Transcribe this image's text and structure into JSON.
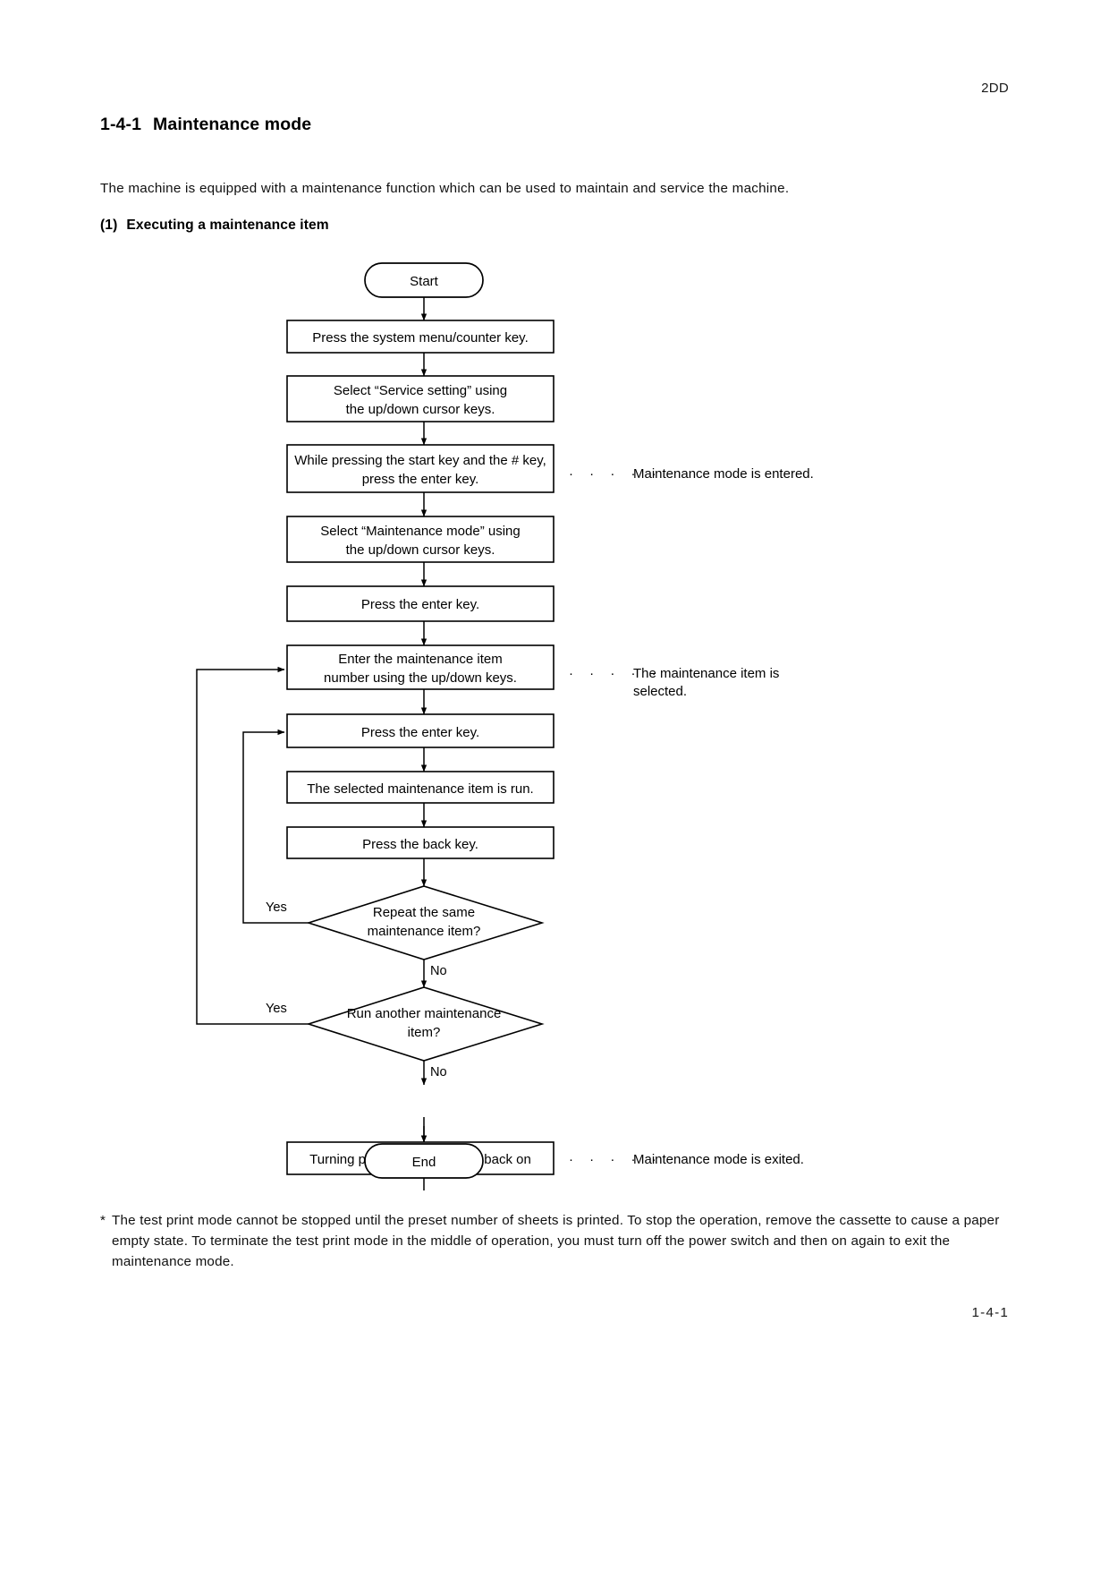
{
  "header": {
    "doc_code": "2DD"
  },
  "section": {
    "number": "1-4-1",
    "title": "Maintenance mode"
  },
  "intro": "The machine is equipped with a maintenance function which can be used to maintain and service the machine.",
  "subsection": {
    "number": "(1)",
    "title": "Executing a maintenance item"
  },
  "flowchart": {
    "type": "flowchart",
    "nodes": {
      "start": "Start",
      "step1": "Press the system menu/counter key.",
      "step2_line1": "Select “Service setting” using",
      "step2_line2": "the up/down cursor keys.",
      "step3_line1": "While pressing the start key and the # key,",
      "step3_line2": "press the enter key.",
      "step4_line1": "Select “Maintenance mode” using",
      "step4_line2": "the up/down cursor keys.",
      "step5": "Press the enter key.",
      "step6_line1": "Enter the maintenance item",
      "step6_line2": "number using the up/down keys.",
      "step7": "Press the enter key.",
      "step8": "The selected maintenance item is run.",
      "step9": "Press the back key.",
      "decision1_line1": "Repeat the same",
      "decision1_line2": "maintenance item?",
      "decision2_line1": "Run another maintenance",
      "decision2_line2": "item?",
      "step10": "Turning power switch off and back on",
      "end": "End"
    },
    "edge_labels": {
      "d1_yes": "Yes",
      "d1_no": "No",
      "d2_yes": "Yes",
      "d2_no": "No"
    },
    "notes": {
      "dots": "· · · · ·",
      "note1": "Maintenance mode is entered.",
      "note2_line1": "The maintenance item is",
      "note2_line2": "selected.",
      "note3": "Maintenance mode is exited."
    }
  },
  "footnote": {
    "marker": "*",
    "text": "The test print mode cannot be stopped until the preset number of sheets is printed. To stop the operation, remove the cassette to cause a paper empty state. To terminate the test print mode in the middle of operation, you must turn off the power switch and then on again to exit the maintenance mode."
  },
  "page_number": "1-4-1"
}
